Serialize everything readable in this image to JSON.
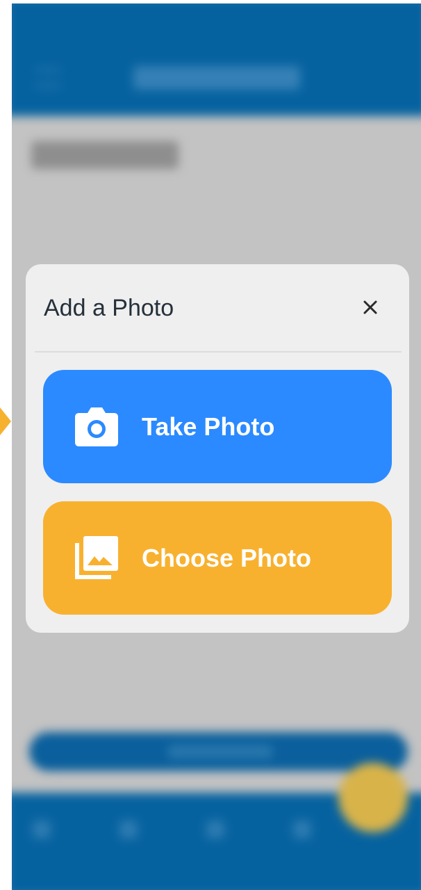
{
  "modal": {
    "title": "Add a Photo",
    "close_icon": "close-icon",
    "take_photo": {
      "label": "Take Photo",
      "icon": "camera-icon",
      "color": "#2b8aff"
    },
    "choose_photo": {
      "label": "Choose Photo",
      "icon": "gallery-icon",
      "color": "#f8b12f"
    }
  },
  "colors": {
    "app_bar": "#06629f",
    "overlay": "#c3c3c3",
    "modal_bg": "#efefef",
    "fab": "#d8b34a"
  }
}
